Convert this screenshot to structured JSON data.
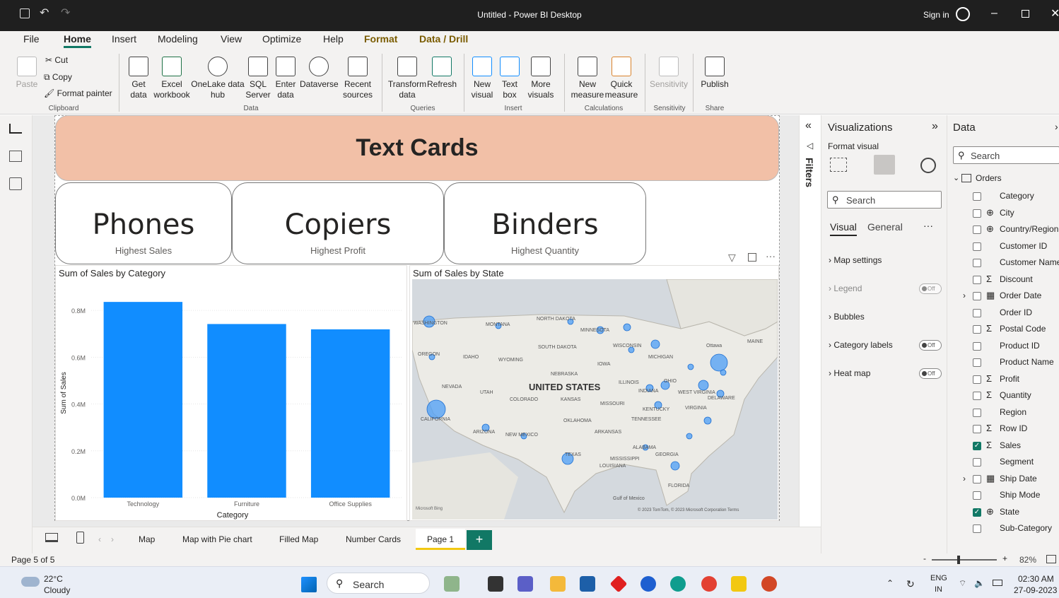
{
  "window": {
    "title": "Untitled - Power BI Desktop",
    "sign_in": "Sign in"
  },
  "menu": [
    "File",
    "Home",
    "Insert",
    "Modeling",
    "View",
    "Optimize",
    "Help",
    "Format",
    "Data / Drill"
  ],
  "ribbon": {
    "clipboard": {
      "paste": "Paste",
      "cut": "Cut",
      "copy": "Copy",
      "format_painter": "Format painter",
      "group": "Clipboard"
    },
    "data": {
      "get_data": "Get data",
      "excel": "Excel workbook",
      "onelake": "OneLake data hub",
      "sql": "SQL Server",
      "enter": "Enter data",
      "dataverse": "Dataverse",
      "recent": "Recent sources",
      "group": "Data"
    },
    "queries": {
      "transform": "Transform data",
      "refresh": "Refresh",
      "group": "Queries"
    },
    "insert": {
      "new_visual": "New visual",
      "text_box": "Text box",
      "more_visuals": "More visuals",
      "group": "Insert"
    },
    "calculations": {
      "new_measure": "New measure",
      "quick_measure": "Quick measure",
      "group": "Calculations"
    },
    "sensitivity": {
      "label": "Sensitivity",
      "group": "Sensitivity"
    },
    "share": {
      "publish": "Publish",
      "group": "Share"
    }
  },
  "report": {
    "banner": "Text Cards",
    "cards": [
      {
        "value": "Phones",
        "label": "Highest Sales"
      },
      {
        "value": "Copiers",
        "label": "Highest Profit"
      },
      {
        "value": "Binders",
        "label": "Highest Quantity"
      }
    ]
  },
  "chart_data": [
    {
      "type": "bar",
      "title": "Sum of Sales by Category",
      "xlabel": "Category",
      "ylabel": "Sum of Sales",
      "categories": [
        "Technology",
        "Furniture",
        "Office Supplies"
      ],
      "values": [
        836154,
        741718,
        719047
      ],
      "yticks": [
        "0.0M",
        "0.2M",
        "0.4M",
        "0.6M",
        "0.8M"
      ],
      "ylim": [
        0,
        900000
      ],
      "color": "#118dff"
    },
    {
      "type": "map",
      "title": "Sum of Sales by State",
      "country_label": "UNITED STATES",
      "labels": [
        "WASHINGTON",
        "MONTANA",
        "NORTH DAKOTA",
        "MINNESOTA",
        "OREGON",
        "IDAHO",
        "SOUTH DAKOTA",
        "WYOMING",
        "WISCONSIN",
        "MICHIGAN",
        "Ottawa",
        "NEBRASKA",
        "IOWA",
        "ILLINOIS",
        "OHIO",
        "NEVADA",
        "UTAH",
        "COLORADO",
        "KANSAS",
        "MISSOURI",
        "INDIANA",
        "WEST VIRGINIA",
        "CALIFORNIA",
        "KENTUCKY",
        "VIRGINIA",
        "OKLAHOMA",
        "TENNESSEE",
        "ARIZONA",
        "NEW MEXICO",
        "ARKANSAS",
        "TEXAS",
        "MISSISSIPPI",
        "ALABAMA",
        "GEORGIA",
        "LOUISIANA",
        "FLORIDA",
        "Gulf of Mexico",
        "DELAWARE",
        "MAINE"
      ],
      "credits": "© 2023 TomTom, © 2023 Microsoft Corporation  Terms",
      "bing": "Microsoft Bing"
    }
  ],
  "panes": {
    "filters": "Filters",
    "visualizations": {
      "title": "Visualizations",
      "format_visual": "Format visual",
      "search": "Search",
      "tab_visual": "Visual",
      "tab_general": "General",
      "sections": [
        {
          "label": "Map settings"
        },
        {
          "label": "Legend",
          "toggle": "Off"
        },
        {
          "label": "Bubbles"
        },
        {
          "label": "Category labels",
          "toggle": "Off"
        },
        {
          "label": "Heat map",
          "toggle": "Off"
        }
      ]
    },
    "data": {
      "title": "Data",
      "search": "Search",
      "table": "Orders",
      "fields": [
        {
          "name": "Category",
          "checked": false
        },
        {
          "name": "City",
          "checked": false
        },
        {
          "name": "Country/Region",
          "checked": false
        },
        {
          "name": "Customer ID",
          "checked": false
        },
        {
          "name": "Customer Name",
          "checked": false
        },
        {
          "name": "Discount",
          "checked": false
        },
        {
          "name": "Order Date",
          "checked": false
        },
        {
          "name": "Order ID",
          "checked": false
        },
        {
          "name": "Postal Code",
          "checked": false
        },
        {
          "name": "Product ID",
          "checked": false
        },
        {
          "name": "Product Name",
          "checked": false
        },
        {
          "name": "Profit",
          "checked": false
        },
        {
          "name": "Quantity",
          "checked": false
        },
        {
          "name": "Region",
          "checked": false
        },
        {
          "name": "Row ID",
          "checked": false
        },
        {
          "name": "Sales",
          "checked": true
        },
        {
          "name": "Segment",
          "checked": false
        },
        {
          "name": "Ship Date",
          "checked": false
        },
        {
          "name": "Ship Mode",
          "checked": false
        },
        {
          "name": "State",
          "checked": true
        },
        {
          "name": "Sub-Category",
          "checked": false
        }
      ]
    }
  },
  "tabs": [
    "Map",
    "Map with Pie chart",
    "Filled Map",
    "Number Cards",
    "Page 1"
  ],
  "status": {
    "page": "Page 5 of 5",
    "zoom": "82%"
  },
  "taskbar": {
    "temp": "22°C",
    "weather": "Cloudy",
    "search": "Search",
    "lang": "ENG",
    "region": "IN",
    "time": "02:30 AM",
    "date": "27-09-2023"
  }
}
